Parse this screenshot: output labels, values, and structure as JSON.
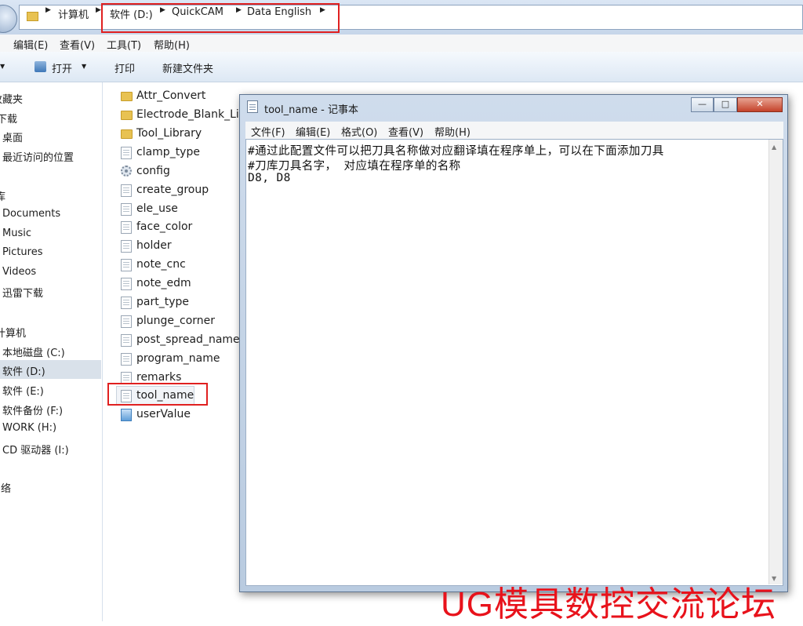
{
  "address": {
    "crumbs": [
      "计算机",
      "软件 (D:)",
      "QuickCAM",
      "Data English"
    ]
  },
  "menubar": {
    "items": [
      "编辑(E)",
      "查看(V)",
      "工具(T)",
      "帮助(H)"
    ]
  },
  "toolbar": {
    "open_label": "打开",
    "print_label": "打印",
    "new_folder_label": "新建文件夹"
  },
  "nav": {
    "favorites_header": "收藏夹",
    "favorites": [
      "下载",
      "桌面",
      "最近访问的位置"
    ],
    "libraries_header": "库",
    "libraries": [
      "Documents",
      "Music",
      "Pictures",
      "Videos",
      "迅雷下载"
    ],
    "computer_header": "计算机",
    "drives": [
      "本地磁盘 (C:)",
      "软件 (D:)",
      "软件 (E:)",
      "软件备份 (F:)",
      "WORK (H:)",
      "CD 驱动器 (I:)"
    ],
    "network_header": "网络"
  },
  "files": [
    {
      "name": "Attr_Convert",
      "icon": "folder-icon"
    },
    {
      "name": "Electrode_Blank_Lib",
      "icon": "folder-icon"
    },
    {
      "name": "Tool_Library",
      "icon": "folder-icon"
    },
    {
      "name": "clamp_type",
      "icon": "text-file-icon"
    },
    {
      "name": "config",
      "icon": "config-file-icon"
    },
    {
      "name": "create_group",
      "icon": "text-file-icon"
    },
    {
      "name": "ele_use",
      "icon": "text-file-icon"
    },
    {
      "name": "face_color",
      "icon": "text-file-icon"
    },
    {
      "name": "holder",
      "icon": "text-file-icon"
    },
    {
      "name": "note_cnc",
      "icon": "text-file-icon"
    },
    {
      "name": "note_edm",
      "icon": "text-file-icon"
    },
    {
      "name": "part_type",
      "icon": "text-file-icon"
    },
    {
      "name": "plunge_corner",
      "icon": "text-file-icon"
    },
    {
      "name": "post_spread_name",
      "icon": "text-file-icon"
    },
    {
      "name": "program_name",
      "icon": "text-file-icon"
    },
    {
      "name": "remarks",
      "icon": "text-file-icon"
    },
    {
      "name": "tool_name",
      "icon": "text-file-icon"
    },
    {
      "name": "userValue",
      "icon": "data-file-icon"
    }
  ],
  "notepad": {
    "title": "tool_name - 记事本",
    "menu": [
      "文件(F)",
      "编辑(E)",
      "格式(O)",
      "查看(V)",
      "帮助(H)"
    ],
    "lines": [
      "#通过此配置文件可以把刀具名称做对应翻译填在程序单上，可以在下面添加刀具",
      "#刀库刀具名字， 对应填在程序单的名称",
      "D8, D8"
    ]
  },
  "watermark": "UG模具数控交流论坛",
  "colors": {
    "highlight_box": "#e02020",
    "watermark": "#e8121b"
  }
}
